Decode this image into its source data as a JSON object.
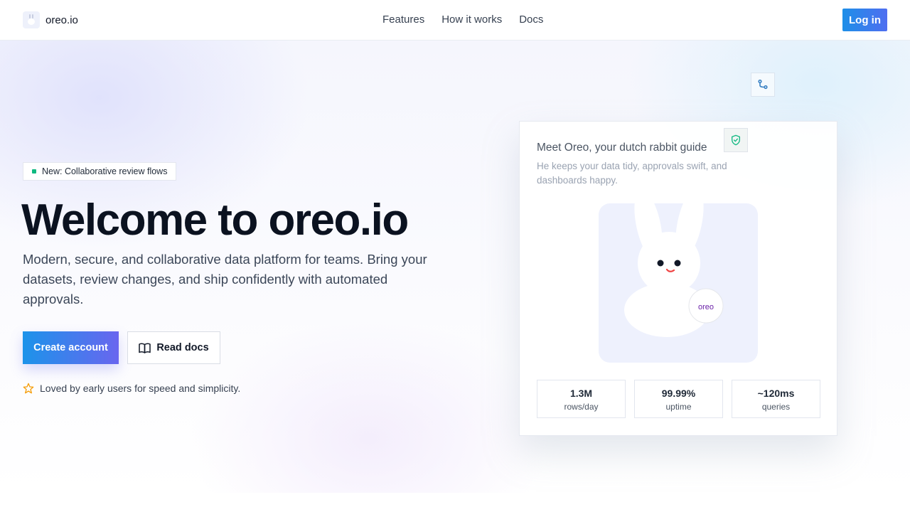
{
  "header": {
    "brand": "oreo.io",
    "nav": [
      "Features",
      "How it works",
      "Docs"
    ],
    "login": "Log in"
  },
  "hero": {
    "badge": "New: Collaborative review flows",
    "title": "Welcome to oreo.io",
    "subtitle": "Modern, secure, and collaborative data platform for teams. Bring your datasets, review changes, and ship confidently with automated approvals.",
    "cta_primary": "Create account",
    "cta_secondary": "Read docs",
    "loved": "Loved by early users for speed and simplicity."
  },
  "card": {
    "title": "Meet Oreo, your dutch rabbit guide",
    "desc": "He keeps your data tidy, approvals swift, and dashboards happy.",
    "tag": "oreo",
    "stats": [
      {
        "value": "1.3M",
        "label": "rows/day"
      },
      {
        "value": "99.99%",
        "label": "uptime"
      },
      {
        "value": "~120ms",
        "label": "queries"
      }
    ]
  },
  "colors": {
    "accent": "#1e8fe8",
    "accent_end": "#6966ef",
    "badge_dot": "#10b981",
    "star": "#f59e0b"
  },
  "icons": [
    "git-branch-icon",
    "shield-check-icon",
    "book-icon",
    "star-icon"
  ]
}
